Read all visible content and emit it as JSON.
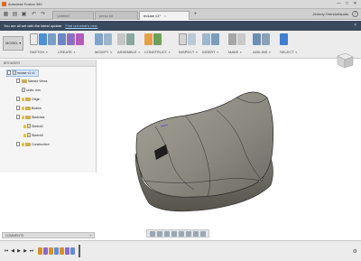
{
  "window": {
    "title": "Autodesk Fusion 360",
    "controls": [
      "—",
      "□",
      "✕"
    ]
  },
  "tabs": [
    {
      "label": "Untitled",
      "active": false
    },
    {
      "label": "press kit",
      "active": false
    },
    {
      "label": "mouse v1*",
      "active": true
    }
  ],
  "account": {
    "name": "Jeremy Orendorlaudio",
    "help": "?"
  },
  "notice": {
    "text": "You are all set with the latest update.",
    "link": "Find out what's new."
  },
  "toolbar": {
    "workspace": "MODEL",
    "groups": [
      {
        "label": "SKETCH",
        "icons": 3
      },
      {
        "label": "CREATE",
        "icons": 4
      },
      {
        "label": "MODIFY",
        "icons": 2
      },
      {
        "label": "ASSEMBLE",
        "icons": 2
      },
      {
        "label": "CONSTRUCT",
        "icons": 2
      },
      {
        "label": "INSPECT",
        "icons": 2
      },
      {
        "label": "INSERT",
        "icons": 2
      },
      {
        "label": "MAKE",
        "icons": 2
      },
      {
        "label": "ADD-INS",
        "icons": 2
      },
      {
        "label": "SELECT",
        "icons": 1
      }
    ]
  },
  "browser": {
    "title": "BROWSER",
    "nodes": [
      {
        "label": "mouse v1 v1",
        "kind": "root"
      },
      {
        "label": "Named Views",
        "kind": "folder"
      },
      {
        "label": "Units: mm",
        "kind": "doc"
      },
      {
        "label": "Origin",
        "kind": "folder"
      },
      {
        "label": "Bodies",
        "kind": "folder"
      },
      {
        "label": "Sketches",
        "kind": "folder"
      },
      {
        "label": "Sketch2",
        "kind": "sketch"
      },
      {
        "label": "Sketch5",
        "kind": "sketch"
      },
      {
        "label": "Construction",
        "kind": "folder"
      }
    ]
  },
  "comments": {
    "label": "COMMENTS",
    "add": "+"
  },
  "colors": {
    "notice_bg": "#3a4a5e",
    "model_body": "#8c8a80",
    "model_edge": "#2a2a2a",
    "accent_orange": "#e06a1b"
  }
}
